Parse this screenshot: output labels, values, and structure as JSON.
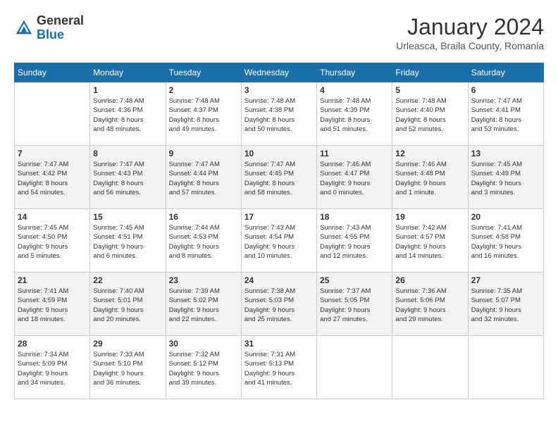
{
  "header": {
    "logo_general": "General",
    "logo_blue": "Blue",
    "title": "January 2024",
    "subtitle": "Urleasca, Braila County, Romania"
  },
  "weekdays": [
    "Sunday",
    "Monday",
    "Tuesday",
    "Wednesday",
    "Thursday",
    "Friday",
    "Saturday"
  ],
  "weeks": [
    [
      {
        "day": "",
        "info": ""
      },
      {
        "day": "1",
        "info": "Sunrise: 7:48 AM\nSunset: 4:36 PM\nDaylight: 8 hours\nand 48 minutes."
      },
      {
        "day": "2",
        "info": "Sunrise: 7:48 AM\nSunset: 4:37 PM\nDaylight: 8 hours\nand 49 minutes."
      },
      {
        "day": "3",
        "info": "Sunrise: 7:48 AM\nSunset: 4:38 PM\nDaylight: 8 hours\nand 50 minutes."
      },
      {
        "day": "4",
        "info": "Sunrise: 7:48 AM\nSunset: 4:39 PM\nDaylight: 8 hours\nand 51 minutes."
      },
      {
        "day": "5",
        "info": "Sunrise: 7:48 AM\nSunset: 4:40 PM\nDaylight: 8 hours\nand 52 minutes."
      },
      {
        "day": "6",
        "info": "Sunrise: 7:47 AM\nSunset: 4:41 PM\nDaylight: 8 hours\nand 53 minutes."
      }
    ],
    [
      {
        "day": "7",
        "info": "Sunrise: 7:47 AM\nSunset: 4:42 PM\nDaylight: 8 hours\nand 54 minutes."
      },
      {
        "day": "8",
        "info": "Sunrise: 7:47 AM\nSunset: 4:43 PM\nDaylight: 8 hours\nand 56 minutes."
      },
      {
        "day": "9",
        "info": "Sunrise: 7:47 AM\nSunset: 4:44 PM\nDaylight: 8 hours\nand 57 minutes."
      },
      {
        "day": "10",
        "info": "Sunrise: 7:47 AM\nSunset: 4:45 PM\nDaylight: 8 hours\nand 58 minutes."
      },
      {
        "day": "11",
        "info": "Sunrise: 7:46 AM\nSunset: 4:47 PM\nDaylight: 9 hours\nand 0 minutes."
      },
      {
        "day": "12",
        "info": "Sunrise: 7:46 AM\nSunset: 4:48 PM\nDaylight: 9 hours\nand 1 minute."
      },
      {
        "day": "13",
        "info": "Sunrise: 7:45 AM\nSunset: 4:49 PM\nDaylight: 9 hours\nand 3 minutes."
      }
    ],
    [
      {
        "day": "14",
        "info": "Sunrise: 7:45 AM\nSunset: 4:50 PM\nDaylight: 9 hours\nand 5 minutes."
      },
      {
        "day": "15",
        "info": "Sunrise: 7:45 AM\nSunset: 4:51 PM\nDaylight: 9 hours\nand 6 minutes."
      },
      {
        "day": "16",
        "info": "Sunrise: 7:44 AM\nSunset: 4:53 PM\nDaylight: 9 hours\nand 8 minutes."
      },
      {
        "day": "17",
        "info": "Sunrise: 7:43 AM\nSunset: 4:54 PM\nDaylight: 9 hours\nand 10 minutes."
      },
      {
        "day": "18",
        "info": "Sunrise: 7:43 AM\nSunset: 4:55 PM\nDaylight: 9 hours\nand 12 minutes."
      },
      {
        "day": "19",
        "info": "Sunrise: 7:42 AM\nSunset: 4:57 PM\nDaylight: 9 hours\nand 14 minutes."
      },
      {
        "day": "20",
        "info": "Sunrise: 7:41 AM\nSunset: 4:58 PM\nDaylight: 9 hours\nand 16 minutes."
      }
    ],
    [
      {
        "day": "21",
        "info": "Sunrise: 7:41 AM\nSunset: 4:59 PM\nDaylight: 9 hours\nand 18 minutes."
      },
      {
        "day": "22",
        "info": "Sunrise: 7:40 AM\nSunset: 5:01 PM\nDaylight: 9 hours\nand 20 minutes."
      },
      {
        "day": "23",
        "info": "Sunrise: 7:39 AM\nSunset: 5:02 PM\nDaylight: 9 hours\nand 22 minutes."
      },
      {
        "day": "24",
        "info": "Sunrise: 7:38 AM\nSunset: 5:03 PM\nDaylight: 9 hours\nand 25 minutes."
      },
      {
        "day": "25",
        "info": "Sunrise: 7:37 AM\nSunset: 5:05 PM\nDaylight: 9 hours\nand 27 minutes."
      },
      {
        "day": "26",
        "info": "Sunrise: 7:36 AM\nSunset: 5:06 PM\nDaylight: 9 hours\nand 29 minutes."
      },
      {
        "day": "27",
        "info": "Sunrise: 7:35 AM\nSunset: 5:07 PM\nDaylight: 9 hours\nand 32 minutes."
      }
    ],
    [
      {
        "day": "28",
        "info": "Sunrise: 7:34 AM\nSunset: 5:09 PM\nDaylight: 9 hours\nand 34 minutes."
      },
      {
        "day": "29",
        "info": "Sunrise: 7:33 AM\nSunset: 5:10 PM\nDaylight: 9 hours\nand 36 minutes."
      },
      {
        "day": "30",
        "info": "Sunrise: 7:32 AM\nSunset: 5:12 PM\nDaylight: 9 hours\nand 39 minutes."
      },
      {
        "day": "31",
        "info": "Sunrise: 7:31 AM\nSunset: 5:13 PM\nDaylight: 9 hours\nand 41 minutes."
      },
      {
        "day": "",
        "info": ""
      },
      {
        "day": "",
        "info": ""
      },
      {
        "day": "",
        "info": ""
      }
    ]
  ]
}
